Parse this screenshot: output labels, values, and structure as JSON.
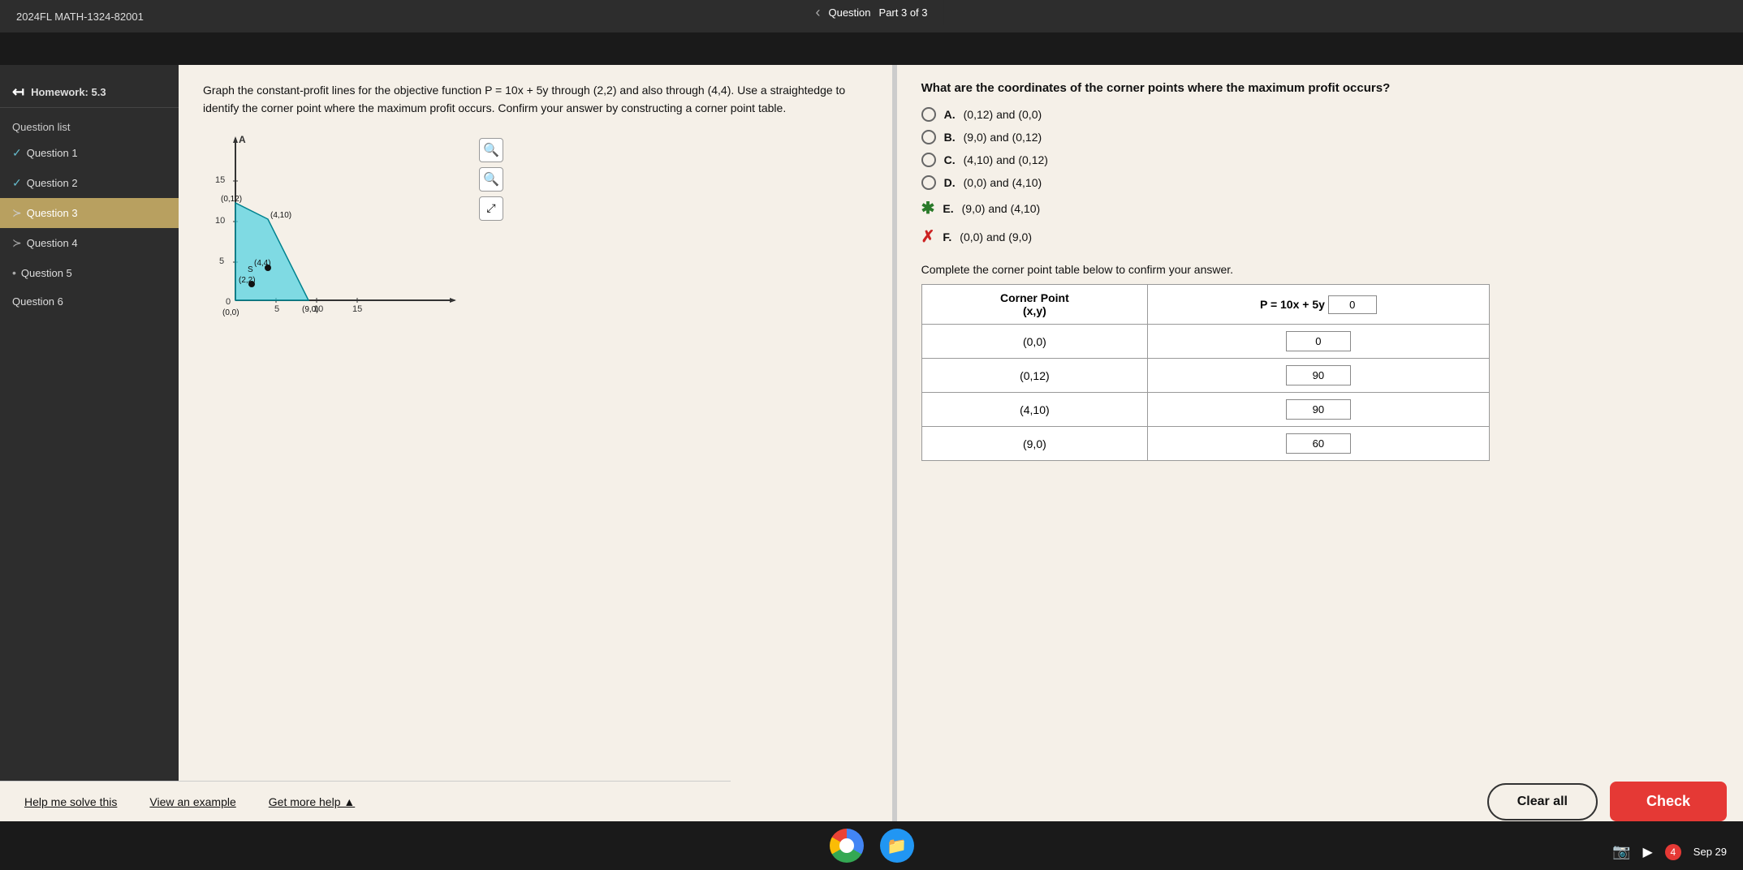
{
  "app": {
    "title": "2024FL MATH-1324-82001",
    "homework": "Homework: 5.3",
    "part_label": "Question",
    "part_info": "Part 3 of 3"
  },
  "sidebar": {
    "back_label": "← ",
    "question_list_label": "Question list",
    "items": [
      {
        "id": "q1",
        "label": "Question 1",
        "status": "check"
      },
      {
        "id": "q2",
        "label": "Question 2",
        "status": "check"
      },
      {
        "id": "q3",
        "label": "Question 3",
        "status": "active"
      },
      {
        "id": "q4",
        "label": "Question 4",
        "status": "partial"
      },
      {
        "id": "q5",
        "label": "Question 5",
        "status": "partial"
      },
      {
        "id": "q6",
        "label": "Question 6",
        "status": "none"
      }
    ]
  },
  "question": {
    "text": "Graph the constant-profit lines for the objective function P = 10x + 5y through (2,2) and also through (4,4). Use a straightedge to identify the corner point where the maximum profit occurs. Confirm your answer by constructing a corner point table.",
    "graph_points": {
      "corner_00": "(0,0)",
      "corner_012": "(0,12)",
      "corner_410": "(4,10)",
      "corner_44": "(4,4)",
      "corner_22": "(2,2)",
      "corner_90": "(9,0)"
    }
  },
  "answer_question": {
    "text": "What are the coordinates of the corner points where the maximum profit occurs?"
  },
  "options": [
    {
      "id": "A",
      "label": "A.",
      "text": "(0,12) and (0,0)",
      "status": "unchecked"
    },
    {
      "id": "B",
      "label": "B.",
      "text": "(9,0) and (0,12)",
      "status": "unchecked"
    },
    {
      "id": "C",
      "label": "C.",
      "text": "(4,10) and (0,12)",
      "status": "unchecked"
    },
    {
      "id": "D",
      "label": "D.",
      "text": "(0,0) and (4,10)",
      "status": "unchecked"
    },
    {
      "id": "E",
      "label": "E.",
      "text": "(9,0) and (4,10)",
      "status": "correct"
    },
    {
      "id": "F",
      "label": "F.",
      "text": "(0,0) and (9,0)",
      "status": "wrong"
    }
  ],
  "table": {
    "instruction": "Complete the corner point table below to confirm your answer.",
    "col1": "Corner Point",
    "col1_sub": "(x,y)",
    "col2": "P = 10x + 5y",
    "col2_val": "0",
    "rows": [
      {
        "point": "(0,0)",
        "value": "0",
        "is_input": false
      },
      {
        "point": "(0,12)",
        "value": "90",
        "is_input": true
      },
      {
        "point": "(4,10)",
        "value": "90",
        "is_input": true
      },
      {
        "point": "(9,0)",
        "value": "60",
        "is_input": true
      }
    ]
  },
  "buttons": {
    "clear_all": "Clear all",
    "check": "Check"
  },
  "bottom_links": {
    "help": "Help me solve this",
    "example": "View an example",
    "more": "Get more help ▲"
  },
  "taskbar": {
    "date": "Sep 29"
  },
  "progress": {
    "labels": [
      "5",
      "10",
      "15"
    ]
  }
}
